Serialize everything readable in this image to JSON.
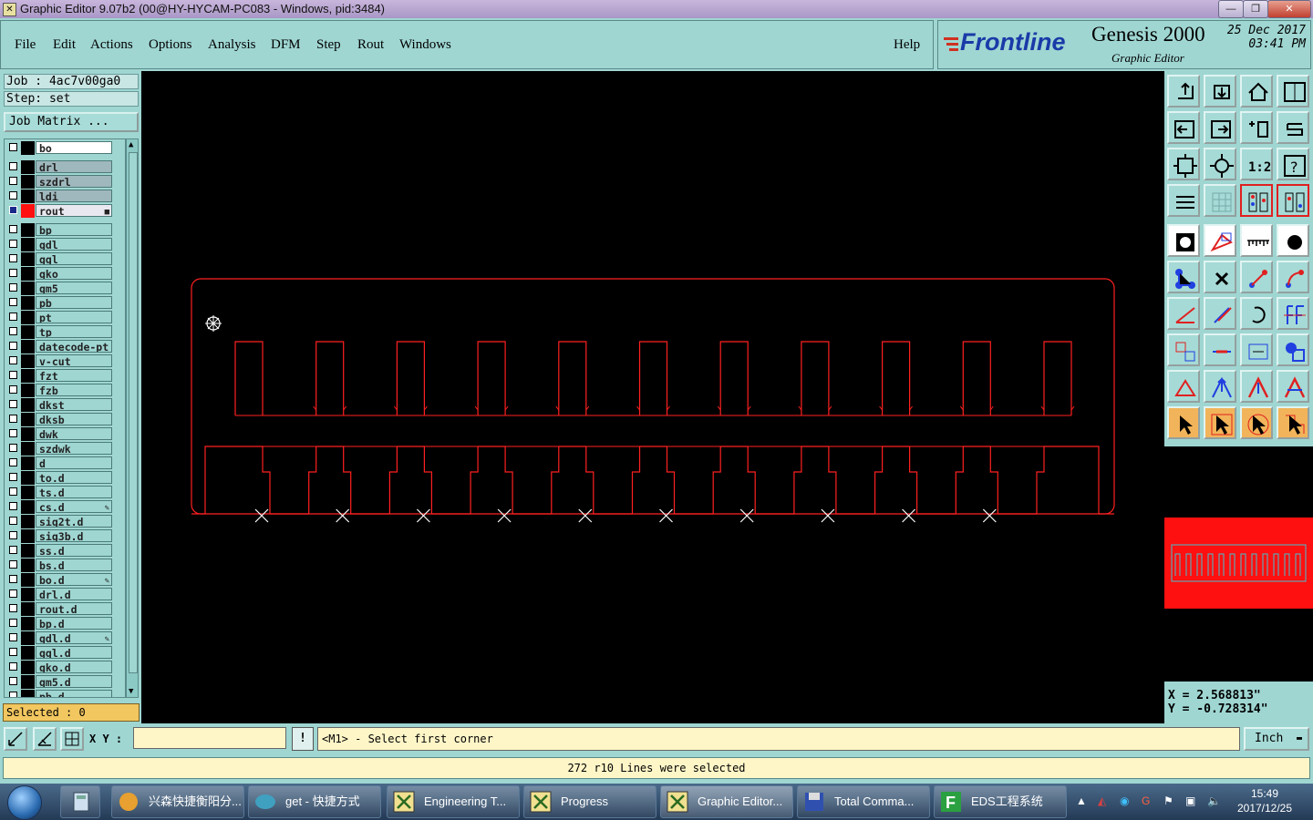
{
  "window": {
    "title": "Graphic Editor 9.07b2 (00@HY-HYCAM-PC083 - Windows, pid:3484)",
    "controls": [
      "—",
      "❐",
      "✕"
    ]
  },
  "menu": {
    "items": [
      "File",
      "Edit",
      "Actions",
      "Options",
      "Analysis",
      "DFM",
      "Step",
      "Rout",
      "Windows"
    ],
    "help": "Help"
  },
  "brand": {
    "logo_text": "Frontline",
    "product": "Genesis 2000",
    "subtitle": "Graphic Editor",
    "date": "25 Dec 2017",
    "time": "03:41 PM"
  },
  "job": {
    "job_line": "Job : 4ac7v00ga0",
    "step_line": "Step: set",
    "matrix_button": "Job Matrix ..."
  },
  "layers": [
    {
      "name": "bo",
      "group": "top"
    },
    {
      "name": "drl",
      "group": "board"
    },
    {
      "name": "szdrl",
      "group": "board"
    },
    {
      "name": "ldi",
      "group": "board"
    },
    {
      "name": "rout",
      "group": "active",
      "mark": "■"
    },
    {
      "name": "bp"
    },
    {
      "name": "gdl"
    },
    {
      "name": "ggl"
    },
    {
      "name": "gko"
    },
    {
      "name": "gm5"
    },
    {
      "name": "pb"
    },
    {
      "name": "pt"
    },
    {
      "name": "tp"
    },
    {
      "name": "datecode-pt"
    },
    {
      "name": "v-cut"
    },
    {
      "name": "fzt"
    },
    {
      "name": "fzb"
    },
    {
      "name": "dkst"
    },
    {
      "name": "dksb"
    },
    {
      "name": "dwk"
    },
    {
      "name": "szdwk"
    },
    {
      "name": "d"
    },
    {
      "name": "to.d"
    },
    {
      "name": "ts.d"
    },
    {
      "name": "cs.d",
      "mark": "✎"
    },
    {
      "name": "sig2t.d"
    },
    {
      "name": "sig3b.d"
    },
    {
      "name": "ss.d"
    },
    {
      "name": "bs.d"
    },
    {
      "name": "bo.d",
      "mark": "✎"
    },
    {
      "name": "drl.d"
    },
    {
      "name": "rout.d"
    },
    {
      "name": "bp.d"
    },
    {
      "name": "gdl.d",
      "mark": "✎"
    },
    {
      "name": "ggl.d"
    },
    {
      "name": "gko.d"
    },
    {
      "name": "gm5.d"
    },
    {
      "name": "pb.d"
    }
  ],
  "selected_label": "Selected : 0",
  "coordinates": {
    "x": "X = 2.568813\"",
    "y": "Y = -0.728314\""
  },
  "command": {
    "xy_label": "X Y :",
    "xy_value": "",
    "bang": "!",
    "prompt": "<M1> - Select first corner",
    "unit": "Inch"
  },
  "status": "272 r10 Lines were selected",
  "colors": {
    "panel": "#9fd6d2",
    "canvas": "#000000",
    "profile": "#ff2020",
    "selected_bar": "#f2c760"
  },
  "toolbar_icons": [
    "zoom-home-icon",
    "zoom-back-icon",
    "home-icon",
    "window-icon",
    "pan-left-icon",
    "pan-right-icon",
    "undo-zoom-icon",
    "redraw-icon",
    "fit-screen-icon",
    "zoom-center-icon",
    "one-to-one-icon",
    "help-icon",
    "snap-icon",
    "grid-icon",
    "layer-display-icon",
    "layer-display-alt-icon",
    "features-icon",
    "draw-icon",
    "ruler-icon",
    "pad-icon",
    "connect-icon",
    "cross-icon",
    "line-icon",
    "arc-icon",
    "angle-icon",
    "slash-icon",
    "rotate-icon",
    "mirror-icon",
    "move-icon",
    "minus-icon",
    "measure-icon",
    "shapes-icon",
    "triangle-icon",
    "arrow-up-icon",
    "arrow-up-alt-icon",
    "arrow-up-alt2-icon",
    "pointer-icon",
    "select-icon",
    "select-alt-icon",
    "snap-pointer-icon"
  ],
  "taskbar": {
    "items": [
      "兴森快捷衡阳分...",
      "get - 快捷方式",
      "Engineering T...",
      "Progress",
      "Graphic Editor...",
      "Total Comma...",
      "EDS工程系统"
    ],
    "time": "15:49",
    "date": "2017/12/25"
  }
}
